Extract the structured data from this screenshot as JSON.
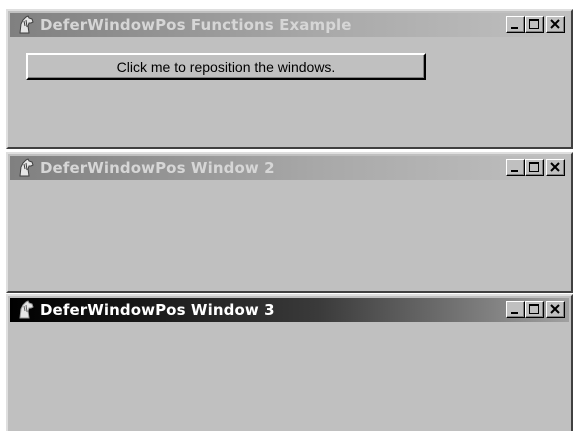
{
  "windows": [
    {
      "title": "DeferWindowPos Functions Example",
      "state": "inactive",
      "icon": "horse-head-icon",
      "button_label": "Click me to reposition the windows."
    },
    {
      "title": "DeferWindowPos Window 2",
      "state": "inactive",
      "icon": "horse-head-icon"
    },
    {
      "title": "DeferWindowPos Window 3",
      "state": "active",
      "icon": "horse-head-icon"
    }
  ],
  "caption_buttons": [
    "minimize",
    "maximize",
    "close"
  ],
  "colors": {
    "face": "#c0c0c0",
    "active_title_start": "#000000",
    "inactive_title_start": "#808080"
  }
}
